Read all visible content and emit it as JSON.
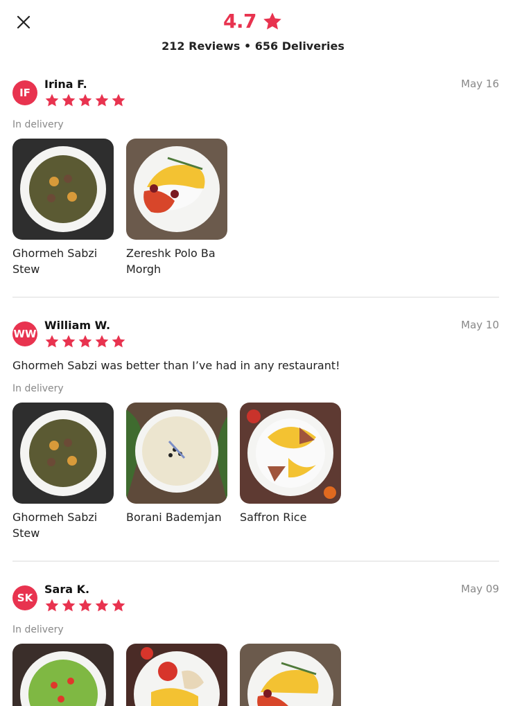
{
  "header": {
    "rating": "4.7",
    "summary": "212 Reviews • 656 Deliveries"
  },
  "icons": {
    "close": "close-icon",
    "star": "star-icon"
  },
  "colors": {
    "accent": "#e8334f",
    "muted_text": "#888888",
    "divider": "#ececec"
  },
  "reviews": [
    {
      "initials": "IF",
      "name": "Irina F.",
      "stars": 5,
      "date": "May 16",
      "comment": "",
      "channel": "In delivery",
      "dishes": [
        {
          "name": "Ghormeh Sabzi Stew"
        },
        {
          "name": "Zereshk Polo Ba Morgh"
        }
      ]
    },
    {
      "initials": "WW",
      "name": "William W.",
      "stars": 5,
      "date": "May 10",
      "comment": "Ghormeh Sabzi was better than I’ve had in any restaurant!",
      "channel": "In delivery",
      "dishes": [
        {
          "name": "Ghormeh Sabzi Stew"
        },
        {
          "name": "Borani Bademjan"
        },
        {
          "name": "Saffron Rice"
        }
      ]
    },
    {
      "initials": "SK",
      "name": "Sara K.",
      "stars": 5,
      "date": "May 09",
      "comment": "",
      "channel": "In delivery",
      "dishes": [
        {
          "name": ""
        },
        {
          "name": ""
        },
        {
          "name": ""
        }
      ]
    }
  ]
}
